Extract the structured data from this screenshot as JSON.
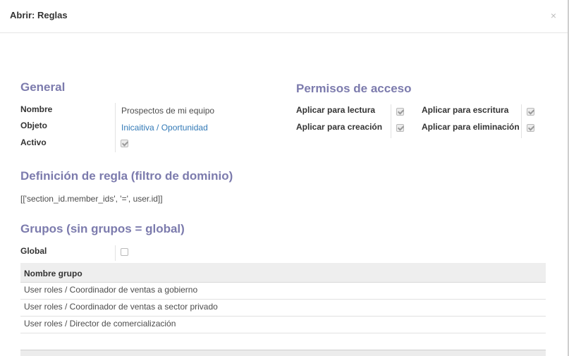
{
  "dialog": {
    "title": "Abrir: Reglas",
    "close_glyph": "×"
  },
  "general": {
    "title": "General",
    "fields": {
      "name_label": "Nombre",
      "name_value": "Prospectos de mi equipo",
      "object_label": "Objeto",
      "object_value": "Inicaitiva / Oportunidad",
      "active_label": "Activo",
      "active_checked": true
    }
  },
  "access": {
    "title": "Permisos de acceso",
    "read_label": "Aplicar para lectura",
    "read_checked": true,
    "write_label": "Aplicar para escritura",
    "write_checked": true,
    "create_label": "Aplicar para creación",
    "create_checked": true,
    "delete_label": "Aplicar para eliminación",
    "delete_checked": true
  },
  "rule": {
    "title": "Definición de regla (filtro de dominio)",
    "domain": "[['section_id.member_ids', '=', user.id]]"
  },
  "groups": {
    "title": "Grupos (sin grupos = global)",
    "global_label": "Global",
    "global_checked": false,
    "column_header": "Nombre grupo",
    "rows": [
      "User roles / Coordinador de ventas a gobierno",
      "User roles / Coordinador de ventas a sector privado",
      "User roles / Director de comercialización"
    ]
  }
}
